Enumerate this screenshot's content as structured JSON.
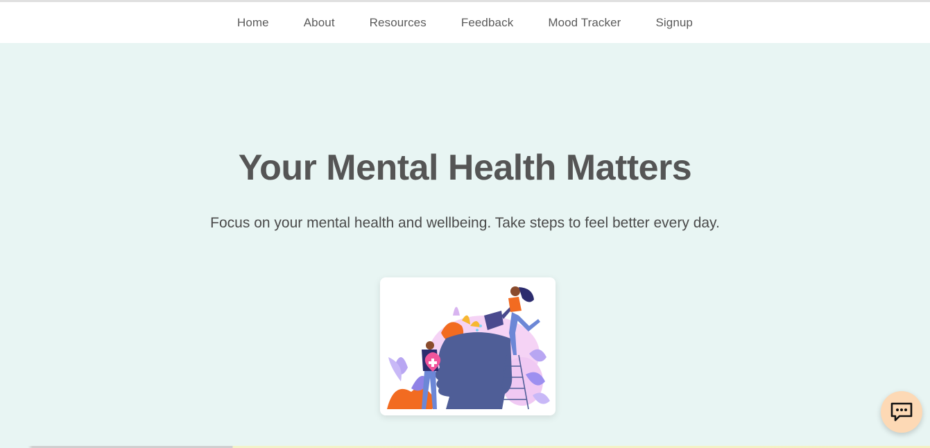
{
  "nav": {
    "items": [
      {
        "label": "Home"
      },
      {
        "label": "About"
      },
      {
        "label": "Resources"
      },
      {
        "label": "Feedback"
      },
      {
        "label": "Mood Tracker"
      },
      {
        "label": "Signup"
      }
    ]
  },
  "hero": {
    "title": "Your Mental Health Matters",
    "subtitle": "Focus on your mental health and wellbeing. Take steps to feel better every day."
  },
  "illustration": {
    "icon": "mental-health-illustration"
  },
  "chat": {
    "icon": "chat-bubble-icon"
  },
  "colors": {
    "hero_bg": "#e8f5f3",
    "title_text": "#555555",
    "chat_bg": "#fdd9b5"
  }
}
